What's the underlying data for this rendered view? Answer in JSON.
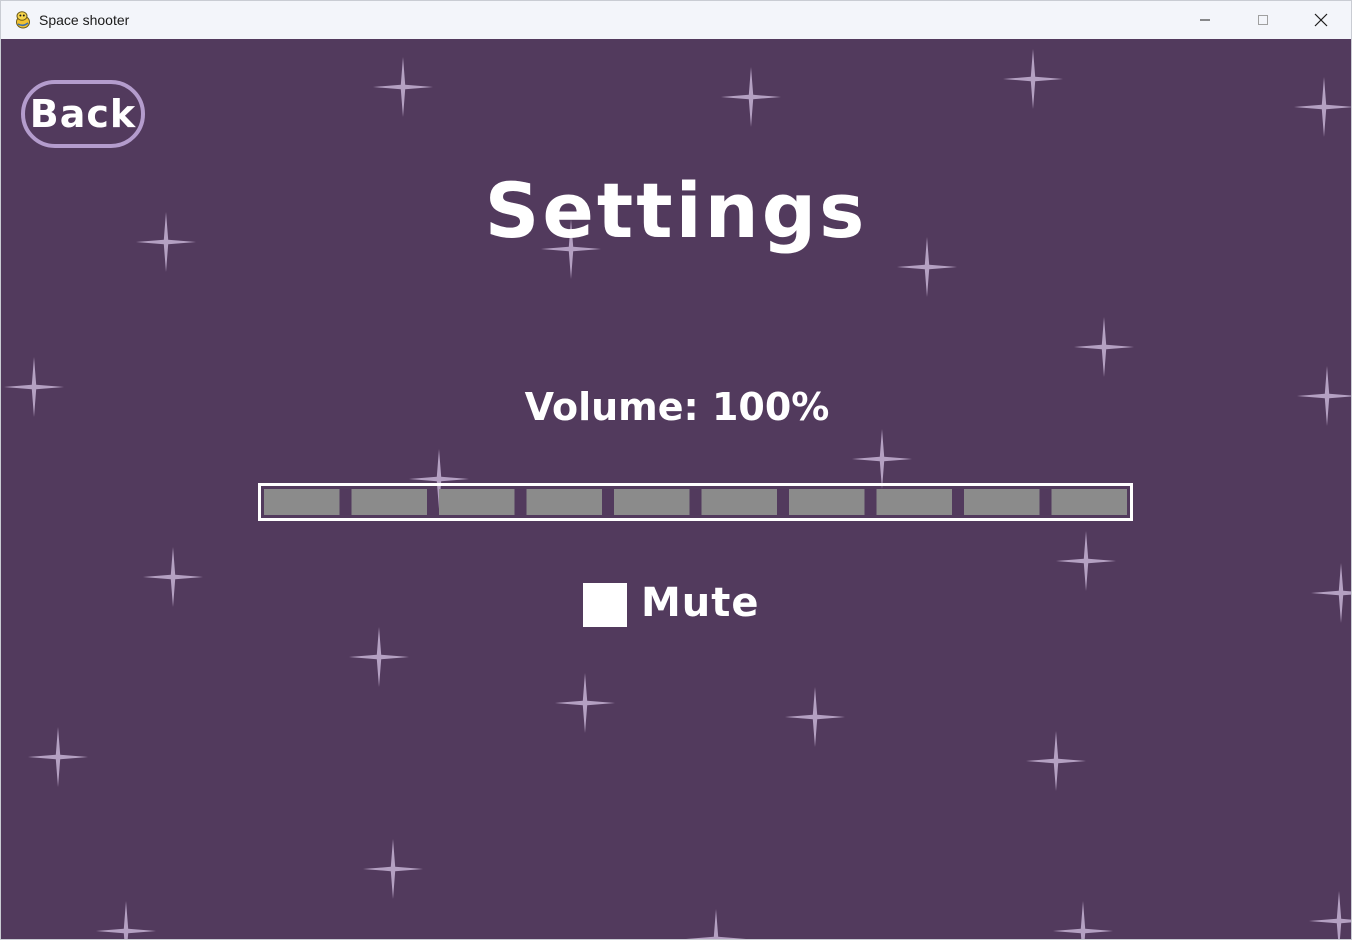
{
  "window": {
    "title": "Space shooter",
    "icon": "pygame-snake-icon",
    "controls": [
      "minimize-icon",
      "maximize-icon",
      "close-icon"
    ]
  },
  "colors": {
    "background": "#523a5d",
    "star": "#c6b3d4",
    "back_border": "#b49ccd",
    "segment": "#8b8b8b",
    "text": "#ffffff"
  },
  "settings": {
    "back_label": "Back",
    "title": "Settings",
    "volume_label": "Volume: 100%",
    "volume": {
      "value_percent": 100,
      "segments_total": 10,
      "segments_filled": 10
    },
    "mute": {
      "label": "Mute",
      "checked": false
    }
  }
}
